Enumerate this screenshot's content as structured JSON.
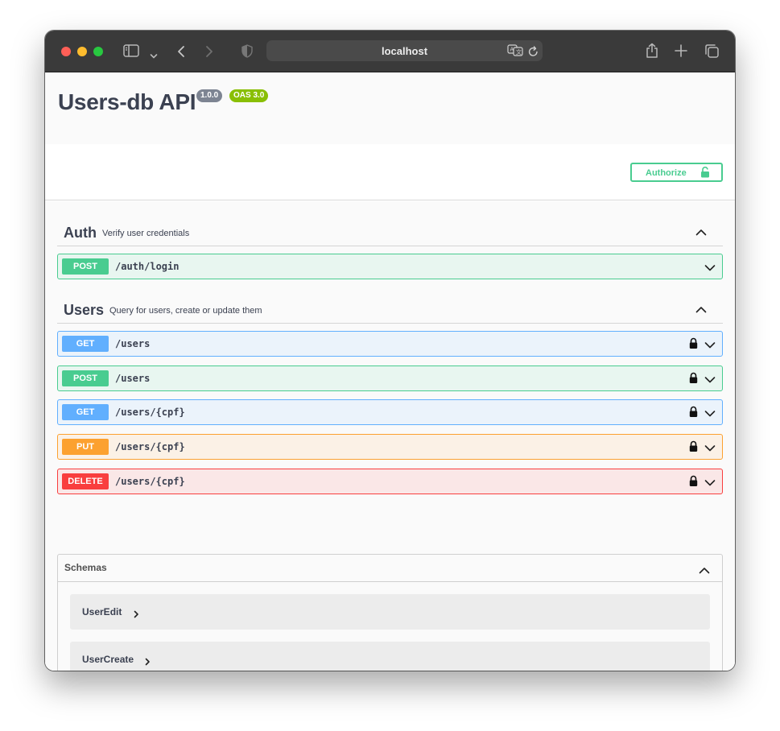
{
  "browser": {
    "url": "localhost"
  },
  "info": {
    "title": "Users-db API",
    "version": "1.0.0",
    "oas": "OAS 3.0"
  },
  "auth_button": {
    "label": "Authorize"
  },
  "tags": [
    {
      "name": "Auth",
      "description": "Verify user credentials",
      "operations": [
        {
          "method": "POST",
          "path": "/auth/login",
          "locked": false
        }
      ]
    },
    {
      "name": "Users",
      "description": "Query for users, create or update them",
      "operations": [
        {
          "method": "GET",
          "path": "/users",
          "locked": true
        },
        {
          "method": "POST",
          "path": "/users",
          "locked": true
        },
        {
          "method": "GET",
          "path": "/users/{cpf}",
          "locked": true
        },
        {
          "method": "PUT",
          "path": "/users/{cpf}",
          "locked": true
        },
        {
          "method": "DELETE",
          "path": "/users/{cpf}",
          "locked": true
        }
      ]
    }
  ],
  "schemas": {
    "title": "Schemas",
    "models": [
      "UserEdit",
      "UserCreate"
    ]
  },
  "colors": {
    "get": "#61affe",
    "post": "#49cc90",
    "put": "#fca130",
    "delete": "#f93e3e",
    "version_badge": "#7d8492",
    "oas_badge": "#89bf04"
  }
}
